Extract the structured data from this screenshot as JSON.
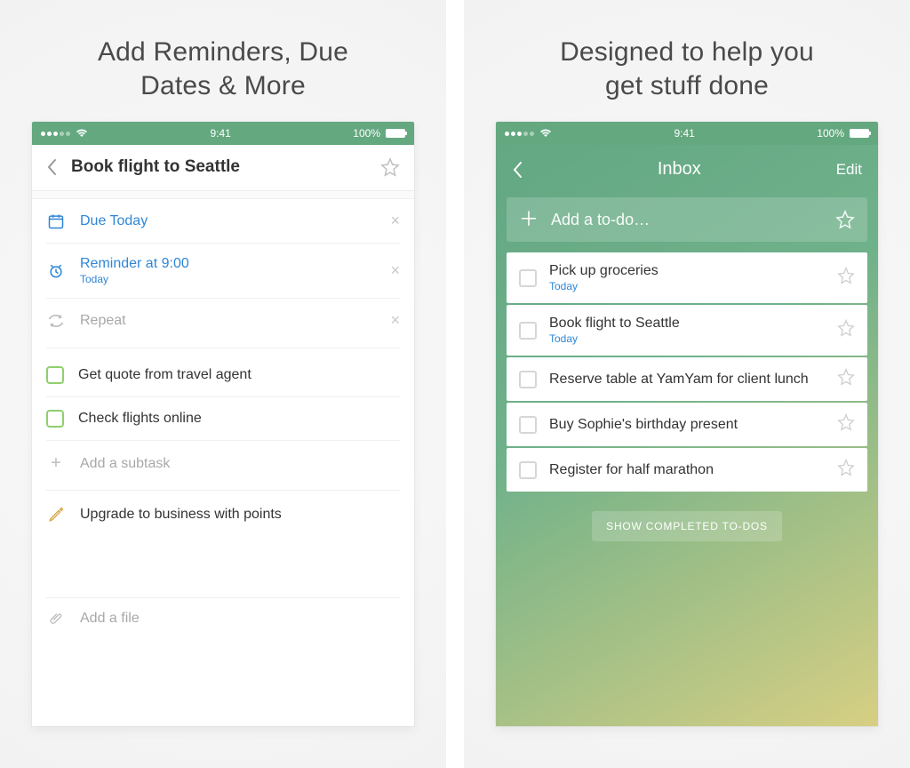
{
  "status": {
    "time": "9:41",
    "battery": "100%"
  },
  "left": {
    "headline": "Add Reminders, Due\nDates & More",
    "task_title": "Book flight to Seattle",
    "due": {
      "label": "Due Today"
    },
    "reminder": {
      "label": "Reminder at 9:00",
      "sub": "Today"
    },
    "repeat": {
      "label": "Repeat"
    },
    "subtasks": [
      {
        "label": "Get quote from travel agent"
      },
      {
        "label": "Check flights online"
      }
    ],
    "add_subtask": "Add a subtask",
    "note": "Upgrade to business with points",
    "add_file": "Add a file"
  },
  "right": {
    "headline": "Designed to help you\nget stuff done",
    "header_title": "Inbox",
    "edit": "Edit",
    "add_todo": "Add a to-do…",
    "todos": [
      {
        "title": "Pick up groceries",
        "sub": "Today"
      },
      {
        "title": "Book flight to Seattle",
        "sub": "Today"
      },
      {
        "title": "Reserve table at YamYam for client lunch",
        "sub": ""
      },
      {
        "title": "Buy Sophie's birthday present",
        "sub": ""
      },
      {
        "title": "Register for half marathon",
        "sub": ""
      }
    ],
    "show_completed": "SHOW COMPLETED TO-DOS"
  }
}
